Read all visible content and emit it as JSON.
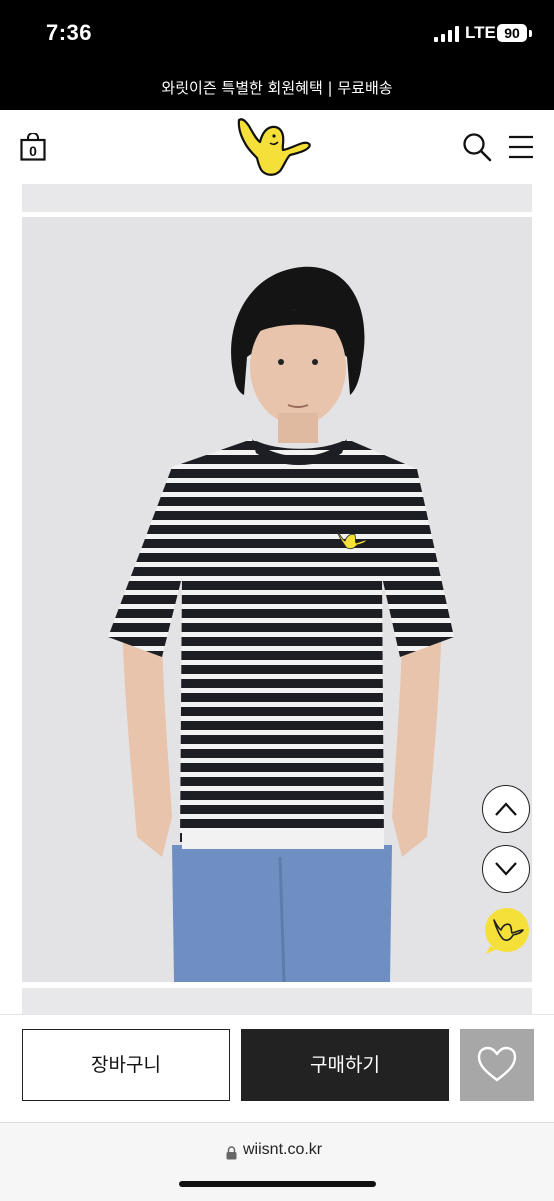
{
  "status_bar": {
    "time": "7:36",
    "network": "LTE",
    "battery": "90"
  },
  "promo": {
    "text": "와릿이즌 특별한 회원혜택 | 무료배송"
  },
  "header": {
    "cart_count": "0"
  },
  "actions": {
    "cart_label": "장바구니",
    "buy_label": "구매하기"
  },
  "browser": {
    "url": "wiisnt.co.kr"
  },
  "icons": {
    "cart": "shopping-bag-icon",
    "logo": "yellow-duck-logo",
    "search": "search-icon",
    "menu": "hamburger-menu-icon",
    "scroll_up": "chevron-up-icon",
    "scroll_down": "chevron-down-icon",
    "chat": "duck-chat-icon",
    "wish": "heart-icon",
    "lock": "lock-icon"
  },
  "colors": {
    "brand_yellow": "#f5e03a",
    "dark": "#222222",
    "wish_gray": "#a7a7a7"
  }
}
